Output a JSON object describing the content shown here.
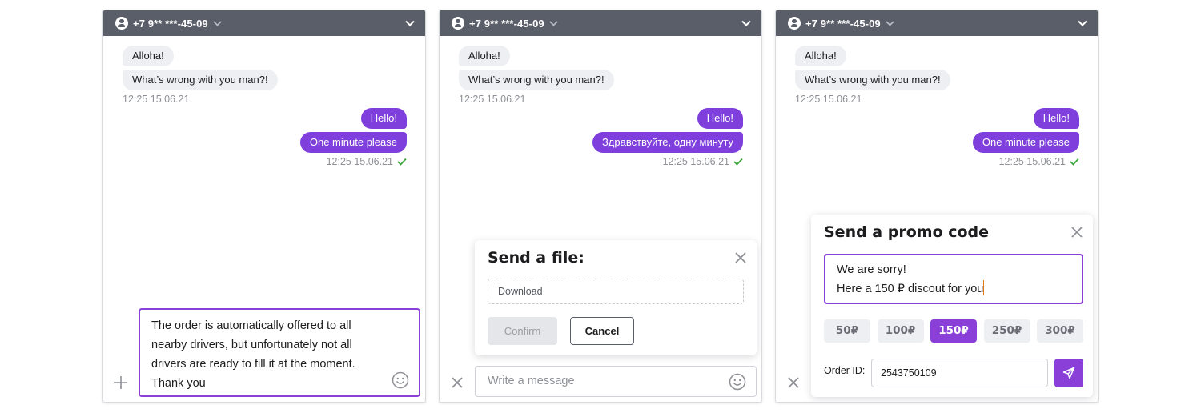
{
  "colors": {
    "header_bg": "#5a5e69",
    "accent": "#7f3fdc",
    "incoming_bubble": "#eeeff2",
    "read_check": "#3aa53a"
  },
  "panels": [
    {
      "header": {
        "phone": "+7 9** ***-45-09",
        "icons": [
          "user-icon",
          "chevron-down-icon"
        ]
      },
      "messages_in": [
        "Alloha!",
        "What’s wrong with you man?!"
      ],
      "time_in": "12:25 15.06.21",
      "messages_out": [
        "Hello!",
        "One minute please"
      ],
      "time_out": "12:25 15.06.21",
      "composer": {
        "lines": [
          "The order is automatically offered to all",
          "nearby drivers, but unfortunately not all",
          "drivers are ready to fill it at the moment.",
          "Thank you"
        ]
      }
    },
    {
      "header": {
        "phone": "+7 9** ***-45-09"
      },
      "messages_in": [
        "Alloha!",
        "What’s wrong with you man?!"
      ],
      "time_in": "12:25 15.06.21",
      "messages_out": [
        "Hello!",
        "Здравствуйте, одну минуту"
      ],
      "time_out": "12:25 15.06.21",
      "file_dialog": {
        "title": "Send a file:",
        "dropzone": "Download",
        "confirm": "Confirm",
        "cancel": "Cancel"
      },
      "composer_placeholder": "Write a message"
    },
    {
      "header": {
        "phone": "+7 9** ***-45-09"
      },
      "messages_in": [
        "Alloha!",
        "What’s wrong with you man?!"
      ],
      "time_in": "12:25 15.06.21",
      "messages_out": [
        "Hello!",
        "One minute please"
      ],
      "time_out": "12:25 15.06.21",
      "promo_dialog": {
        "title": "Send a promo code",
        "text_lines": [
          "We are sorry!",
          "Here a 150 ₽ discout for you"
        ],
        "amounts": [
          "50₽",
          "100₽",
          "150₽",
          "250₽",
          "300₽"
        ],
        "selected_amount": "150₽",
        "order_label": "Order ID:",
        "order_id": "2543750109"
      }
    }
  ]
}
